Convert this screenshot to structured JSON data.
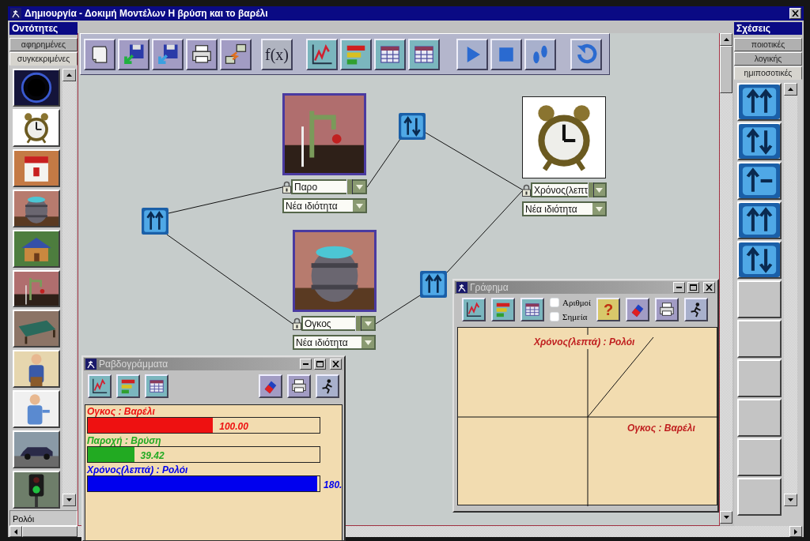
{
  "window": {
    "title": "Δημιουργία - Δοκιμή Μοντέλων Η βρύση και το βαρέλι"
  },
  "entities": {
    "header": "Οντότητες",
    "tabs": [
      {
        "label": "αφηρημένες",
        "selected": false
      },
      {
        "label": "συγκεκριμένες",
        "selected": true
      }
    ],
    "caption": "Ρολόι"
  },
  "toolbar": {
    "formula_button": "f(x)"
  },
  "canvas": {
    "nodes": [
      {
        "kind": "picture",
        "property": "Παρο",
        "new_property": "Νέα ιδιότητα"
      },
      {
        "kind": "picture",
        "property": "Χρόνος(λεπτ",
        "new_property": "Νέα ιδιότητα"
      },
      {
        "kind": "picture",
        "property": "Ογκος",
        "new_property": "Νέα ιδιότητα"
      }
    ],
    "relations": [
      {
        "kind": "up-up"
      },
      {
        "kind": "up-down"
      },
      {
        "kind": "up-up"
      }
    ]
  },
  "relations_panel": {
    "header": "Σχέσεις",
    "tabs": [
      {
        "label": "ποιοτικές",
        "selected": false
      },
      {
        "label": "λογικής",
        "selected": false
      },
      {
        "label": "ημιποσοτικές",
        "selected": true
      }
    ],
    "items": [
      {
        "kind": "up-up"
      },
      {
        "kind": "up-down"
      },
      {
        "kind": "up-minus"
      },
      {
        "kind": "up-up"
      },
      {
        "kind": "up-down"
      }
    ]
  },
  "bar_window": {
    "title": "Ραβδογράμματα",
    "bars": [
      {
        "label": "Ογκος : Βαρέλι",
        "color": "#ee1111",
        "level": 0.54,
        "reading": "100.00"
      },
      {
        "label": "Παροχή : Βρύση",
        "color": "#22aa22",
        "level": 0.2,
        "reading": "39.42"
      },
      {
        "label": "Χρόνος(λεπτά) : Ρολόι",
        "color": "#0000ee",
        "level": 0.99,
        "reading": "180."
      }
    ]
  },
  "graph_window": {
    "title": "Γράφημα",
    "options": [
      {
        "label": "Αριθμοί",
        "checked": false
      },
      {
        "label": "Σημεία",
        "checked": false
      }
    ],
    "help_button": "?",
    "y_label": "Χρόνος(λεπτά) : Ρολόι",
    "x_label": "Ογκος : Βαρέλι"
  }
}
